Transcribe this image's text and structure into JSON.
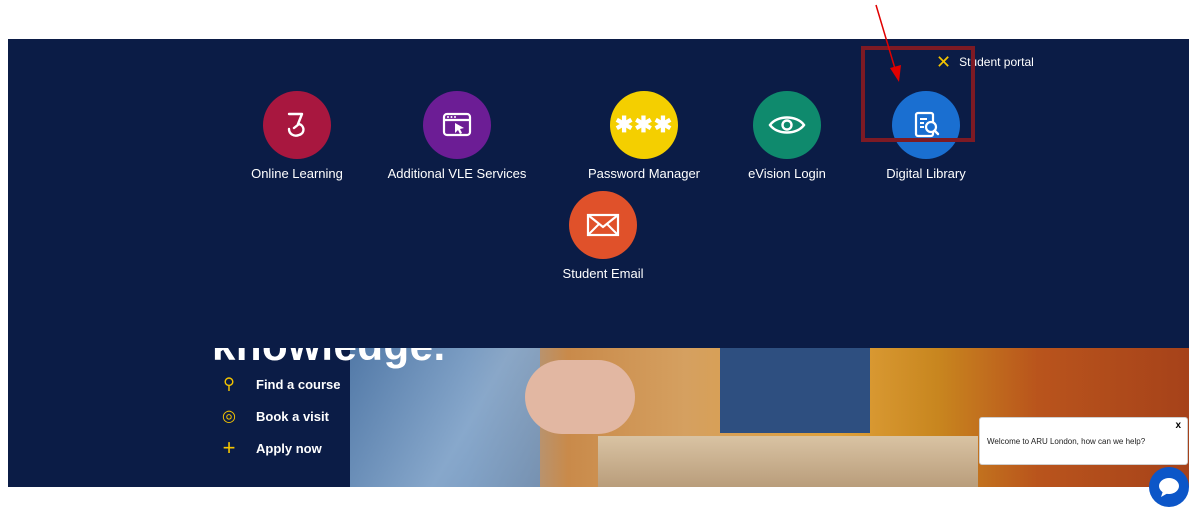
{
  "portal": {
    "close_icon": "close-x-icon",
    "close_label": "Student portal",
    "tiles": [
      {
        "label": "Online Learning",
        "icon": "online-learning-icon",
        "color": "#a8173f"
      },
      {
        "label": "Additional VLE Services",
        "icon": "browser-cursor-icon",
        "color": "#6c1d95"
      },
      {
        "label": "Password Manager",
        "icon": "password-asterisks-icon",
        "color": "#f4cf00"
      },
      {
        "label": "eVision Login",
        "icon": "eye-icon",
        "color": "#0f8a6d"
      },
      {
        "label": "Digital Library",
        "icon": "document-search-icon",
        "color": "#1a6fd1"
      },
      {
        "label": "Student Email",
        "icon": "envelope-icon",
        "color": "#e0512a"
      }
    ]
  },
  "hero": {
    "headline": "knowledge.",
    "links": [
      {
        "label": "Find a course",
        "icon": "search-icon"
      },
      {
        "label": "Book a visit",
        "icon": "location-pin-icon"
      },
      {
        "label": "Apply now",
        "icon": "plus-icon"
      }
    ]
  },
  "chat": {
    "close_label": "x",
    "message": "Welcome to ARU London, how can we help?",
    "icon": "chat-bubble-icon"
  },
  "annotation": {
    "highlight_color": "#7d1a24",
    "arrow_color": "#e00000"
  }
}
